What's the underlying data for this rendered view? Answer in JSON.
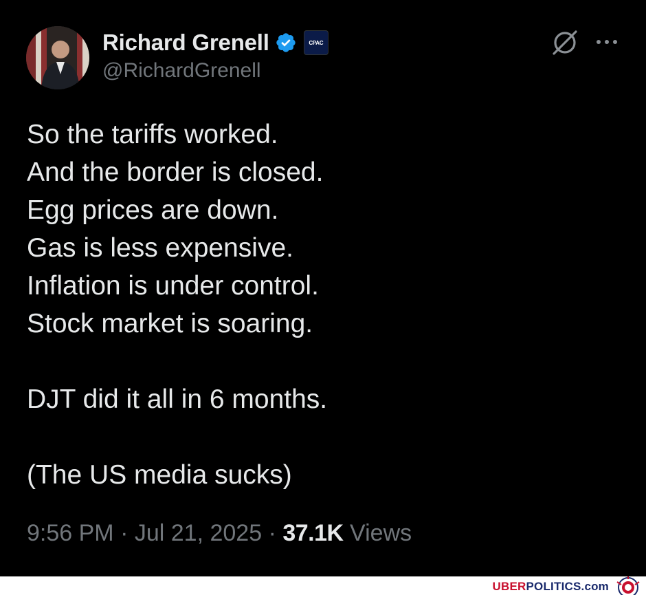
{
  "tweet": {
    "author": {
      "display_name": "Richard Grenell",
      "handle": "@RichardGrenell",
      "verified": true,
      "affiliation_badge": "CPAC"
    },
    "body_lines_1": [
      "So the tariffs worked.",
      "And the border is closed.",
      "Egg prices are down.",
      "Gas is less expensive.",
      "Inflation is under control.",
      "Stock market is soaring."
    ],
    "body_line_2": "DJT did it all in 6 months.",
    "body_line_3": "(The US media sucks)",
    "meta": {
      "time": "9:56 PM",
      "separator": "·",
      "date": "Jul 21, 2025",
      "views_count": "37.1K",
      "views_label": "Views"
    },
    "icons": {
      "verified": "verified-checkmark-icon",
      "grok": "grok-icon",
      "more": "more-options-icon"
    },
    "colors": {
      "background": "#000000",
      "text_primary": "#e7e9ea",
      "text_secondary": "#71767b",
      "verified_blue": "#1d9bf0"
    }
  },
  "watermark": {
    "part_uber": "UBER",
    "part_politics": "POLITICS",
    "part_com": ".com"
  }
}
